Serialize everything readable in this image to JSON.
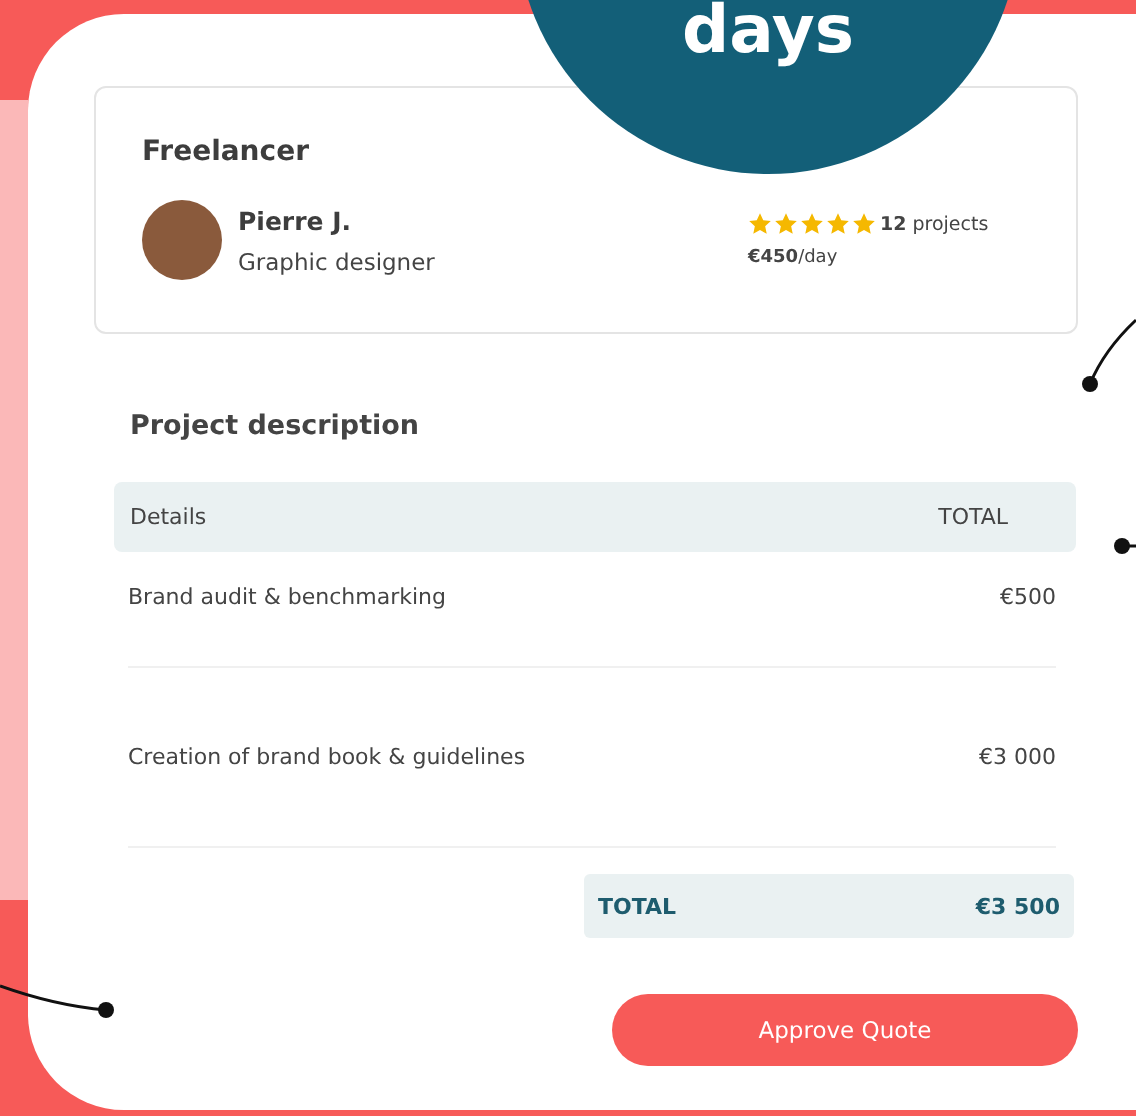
{
  "badge": {
    "text": "days"
  },
  "freelancer": {
    "heading": "Freelancer",
    "name": "Pierre J.",
    "role": "Graphic designer",
    "stars": 5,
    "projects_count": "12",
    "projects_label": "projects",
    "rate": "€450",
    "rate_unit": "/day"
  },
  "project": {
    "heading": "Project description",
    "columns": [
      "Details",
      "TOTAL"
    ],
    "rows": [
      {
        "details": "Brand audit & benchmarking",
        "total": "€500"
      },
      {
        "details": "Creation of brand book & guidelines",
        "total": "€3 000"
      }
    ],
    "total_label": "TOTAL",
    "total_value": "€3 500"
  },
  "button": {
    "label": "Approve Quote"
  }
}
